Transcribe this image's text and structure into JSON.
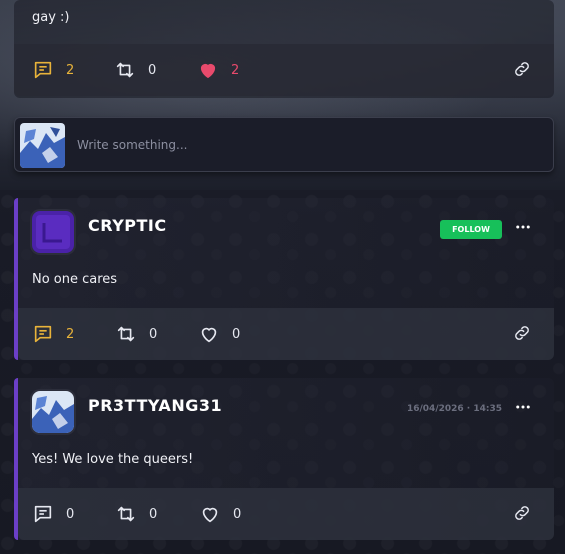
{
  "top_post": {
    "text": "gay :)",
    "comments": "2",
    "reposts": "0",
    "likes": "2"
  },
  "composer": {
    "placeholder": "Write something..."
  },
  "posts": [
    {
      "username": "CRYPTIC",
      "follow_label": "FOLLOW",
      "text": "No one cares",
      "comments": "2",
      "reposts": "0",
      "likes": "0"
    },
    {
      "username": "PR3TTYANG31",
      "timestamp": "16/04/2026 · 14:35",
      "text": "Yes! We love the queers!",
      "comments": "0",
      "reposts": "0",
      "likes": "0"
    }
  ],
  "colors": {
    "accent_yellow": "#e8b33a",
    "like_pink": "#e84a6c",
    "follow_green": "#17c05a",
    "post_border_purple": "#6b3fc7"
  },
  "icons": [
    "comment-icon",
    "repost-icon",
    "heart-icon",
    "link-icon",
    "more-icon"
  ]
}
